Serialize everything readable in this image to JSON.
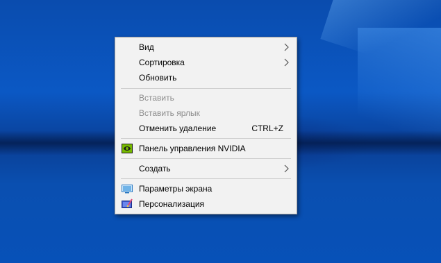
{
  "desktop": {
    "context_menu": {
      "items": [
        {
          "label": "Вид",
          "submenu": true
        },
        {
          "label": "Сортировка",
          "submenu": true
        },
        {
          "label": "Обновить"
        },
        {
          "label": "Вставить",
          "disabled": true
        },
        {
          "label": "Вставить ярлык",
          "disabled": true
        },
        {
          "label": "Отменить удаление",
          "shortcut": "CTRL+Z"
        },
        {
          "label": "Панель управления NVIDIA",
          "icon": "nvidia-icon"
        },
        {
          "label": "Создать",
          "submenu": true
        },
        {
          "label": "Параметры экрана",
          "icon": "display-settings-icon"
        },
        {
          "label": "Персонализация",
          "icon": "personalization-icon"
        }
      ]
    }
  },
  "colors": {
    "menu_background": "#f2f2f2",
    "separator": "#cfcfcf",
    "disabled_text": "#8d8d8d",
    "desktop_blue": "#0b58c4",
    "nvidia_green": "#76b900"
  }
}
